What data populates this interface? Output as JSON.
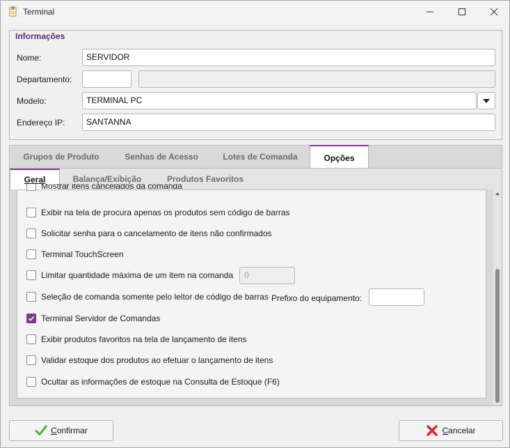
{
  "window": {
    "title": "Terminal",
    "icon": "document-pin-icon"
  },
  "info": {
    "legend": "Informações",
    "nome_label": "Nome:",
    "nome_value": "SERVIDOR",
    "departamento_label": "Departamento:",
    "departamento_code": "",
    "departamento_name": "",
    "modelo_label": "Modelo:",
    "modelo_value": "TERMINAL PC",
    "ip_label": "Endereço IP:",
    "ip_value": "SANTANNA"
  },
  "tabs": [
    {
      "label": "Grupos de Produto",
      "active": false
    },
    {
      "label": "Senhas de Acesso",
      "active": false
    },
    {
      "label": "Lotes de Comanda",
      "active": false
    },
    {
      "label": "Opções",
      "active": true
    }
  ],
  "subtabs": [
    {
      "label": "Geral",
      "active": true
    },
    {
      "label": "Balança/Exibição",
      "active": false
    },
    {
      "label": "Produtos Favoritos",
      "active": false
    }
  ],
  "options": [
    {
      "label": "Mostrar itens cancelados da comanda",
      "checked": false
    },
    {
      "label": "Exibir na tela de procura apenas os produtos sem código de barras",
      "checked": false
    },
    {
      "label": "Solicitar senha para o cancelamento de itens não confirmados",
      "checked": false
    },
    {
      "label": "Terminal TouchScreen",
      "checked": false
    },
    {
      "label": "Limitar quantidade máxima de um item na comanda",
      "checked": false
    },
    {
      "label": "Seleção de comanda somente pelo leitor de código de barras",
      "checked": false
    },
    {
      "label": "Terminal Servidor de Comandas",
      "checked": true
    },
    {
      "label": "Exibir produtos favoritos na tela de lançamento de itens",
      "checked": false
    },
    {
      "label": "Validar estoque dos produtos ao efetuar o lançamento de itens",
      "checked": false
    },
    {
      "label": "Ocultar as informações de estoque na Consulta de Estoque (F6)",
      "checked": false
    }
  ],
  "limit_value": "0",
  "prefix_label": "Prefixo do equipamento:",
  "prefix_value": "",
  "buttons": {
    "confirm_pre": "",
    "confirm_mnemonic": "C",
    "confirm_rest": "onfirmar",
    "cancel_pre": "",
    "cancel_mnemonic": "C",
    "cancel_rest": "ancelar"
  },
  "colors": {
    "accent": "#7a3a8a",
    "confirm_icon": "#4caf2a",
    "cancel_icon": "#d9262c"
  }
}
